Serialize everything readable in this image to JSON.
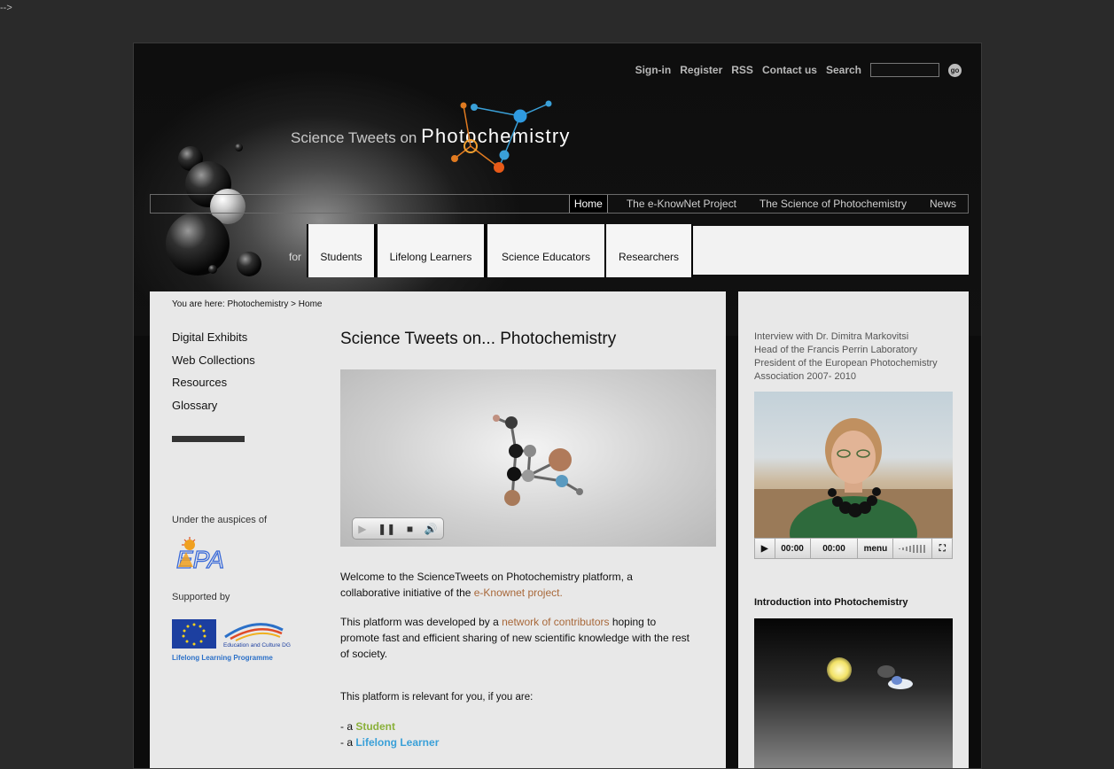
{
  "stray_text": "-->",
  "toplinks": {
    "signin": "Sign-in",
    "register": "Register",
    "rss": "RSS",
    "contact": "Contact us",
    "search_label": "Search",
    "search_value": "",
    "go": "go"
  },
  "logo": {
    "prefix": "Science Tweets on",
    "main": "Photochemistry"
  },
  "mainnav": [
    "Home",
    "The e-KnowNet Project",
    "The Science of Photochemistry",
    "News"
  ],
  "audience": {
    "for": "for",
    "tabs": [
      "Students",
      "Lifelong Learners",
      "Science Educators",
      "Researchers"
    ]
  },
  "breadcrumb": {
    "prefix": "You are here:",
    "path1": "Photochemistry",
    "sep": ">",
    "path2": "Home"
  },
  "sidenav": [
    "Digital Exhibits",
    "Web Collections",
    "Resources",
    "Glossary"
  ],
  "auspices": "Under the auspices of",
  "supported": "Supported by",
  "epa_logo": "EPA",
  "eu_logo": {
    "dg": "Education and Culture DG",
    "programme": "Lifelong Learning Programme"
  },
  "article": {
    "title": "Science Tweets on... Photochemistry",
    "p1_a": "Welcome to the ScienceTweets on Photochemistry platform, a collaborative initiative of the ",
    "p1_link": "e-Knownet project.",
    "p2_a": "This platform was developed by a ",
    "p2_link": "network of contributors",
    "p2_b": " hoping to promote fast and efficient sharing of new scientific knowledge with the rest of society.",
    "p3": "This platform is relevant for you, if you are:",
    "li_prefix": "- a ",
    "li1": "Student",
    "li2": "Lifelong Learner"
  },
  "video_controls": {
    "play": "▶",
    "pause": "❚❚",
    "stop": "■",
    "volume": "🔊"
  },
  "right": {
    "interview": [
      "Interview with Dr. Dimitra Markovitsi",
      "Head of the Francis Perrin Laboratory",
      "President of the European Photochemistry Association 2007- 2010"
    ],
    "player": {
      "play": "▶",
      "time1": "00:00",
      "time2": "00:00",
      "menu": "menu",
      "fullscreen": "⛶"
    },
    "intro_title": "Introduction into Photochemistry"
  }
}
